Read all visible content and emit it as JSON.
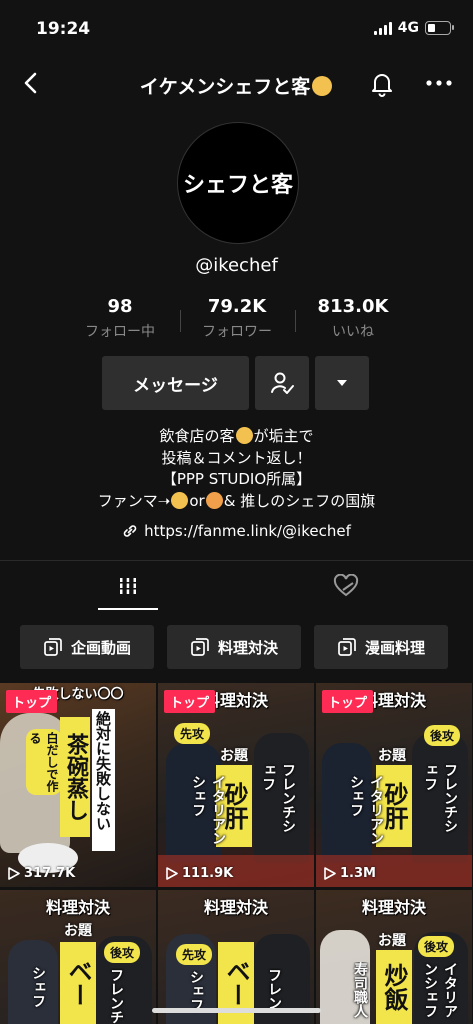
{
  "status_bar": {
    "time": "19:24",
    "network": "4G"
  },
  "nav": {
    "title": "イケメンシェフと客"
  },
  "profile": {
    "avatar_text": "シェフと客",
    "handle": "@ikechef",
    "stats": [
      {
        "value": "98",
        "label": "フォロー中"
      },
      {
        "value": "79.2K",
        "label": "フォロワー"
      },
      {
        "value": "813.0K",
        "label": "いいね"
      }
    ],
    "message_button": "メッセージ",
    "bio": {
      "line1_a": "飲食店の客",
      "line1_b": "が垢主で",
      "line2": "投稿＆コメント返し！",
      "line3": "【PPP STUDIO所属】",
      "line4_a": "ファンマ➝",
      "line4_b": "or",
      "line4_c": "& 推しのシェフの国旗"
    },
    "link": "https://fanme.link/@ikechef"
  },
  "playlists": [
    {
      "label": "企画動画"
    },
    {
      "label": "料理対決"
    },
    {
      "label": "漫画料理"
    }
  ],
  "videos": [
    {
      "badge": "トップ",
      "views": "317.7K",
      "header": "失敗しない〇〇",
      "text_a": "絶対に失敗しない",
      "text_b": "茶碗蒸し",
      "text_c": "白だしで作る"
    },
    {
      "badge": "トップ",
      "views": "111.9K",
      "header": "料理対決",
      "odai": "お題",
      "topic": "砂肝",
      "pill": "先攻",
      "left": "イタリアンシェフ",
      "right": "フレンチシェフ"
    },
    {
      "badge": "トップ",
      "views": "1.3M",
      "header": "料理対決",
      "odai": "お題",
      "topic": "砂肝",
      "pill": "後攻",
      "left": "イタリアンシェフ",
      "right": "フレンチシェフ"
    },
    {
      "header": "料理対決",
      "odai": "お題",
      "topic": "ベー",
      "left": "シェフ",
      "right": "フレンチ",
      "pill": "後攻"
    },
    {
      "header": "料理対決",
      "topic": "ベー",
      "left": "シェフ",
      "right": "フレン",
      "pill": "先攻"
    },
    {
      "header": "料理対決",
      "odai": "お題",
      "topic": "炒飯",
      "left": "寿司職人",
      "right": "イタリアンシェフ",
      "pill": "後攻"
    }
  ],
  "colors": {
    "accent": "#fe2c55",
    "yellow": "#f2e44b",
    "background": "#121212"
  }
}
